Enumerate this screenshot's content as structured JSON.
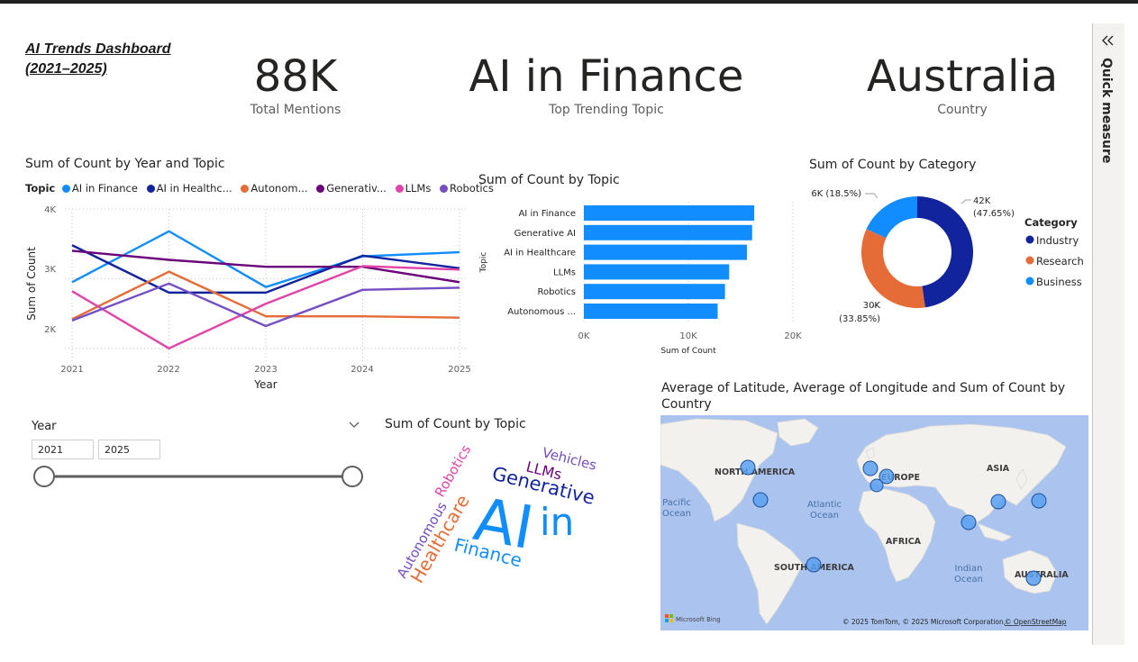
{
  "dashboard": {
    "title_line1": "AI Trends Dashboard ",
    "title_line2": "(2021–2025)"
  },
  "kpis": [
    {
      "value": "88K",
      "label": "Total Mentions"
    },
    {
      "value": "AI in Finance",
      "label": "Top Trending Topic"
    },
    {
      "value": "Australia",
      "label": "Country"
    }
  ],
  "quick_measure": {
    "label": "Quick measure",
    "collapse_icon": "double-chevron-left-icon"
  },
  "line_chart": {
    "title": "Sum of Count by Year and Topic",
    "legend_title": "Topic",
    "legend_items": [
      "AI in Finance",
      "AI in Healthc...",
      "Autonom...",
      "Generativ...",
      "LLMs",
      "Robotics"
    ],
    "xlabel": "Year",
    "ylabel": "Sum of Count",
    "x_ticks": [
      "2021",
      "2022",
      "2023",
      "2024",
      "2025"
    ],
    "y_ticks": [
      "4K",
      "3K",
      "2K"
    ]
  },
  "bar_chart": {
    "title": "Sum of Count by Topic",
    "ylabel": "Topic",
    "xlabel": "Sum of Count",
    "x_ticks": [
      "0K",
      "10K",
      "20K"
    ],
    "categories": [
      "AI in Finance",
      "Generative AI",
      "AI in Healthcare",
      "LLMs",
      "Robotics",
      "Autonomous ..."
    ]
  },
  "donut_chart": {
    "title": "Sum of Count by Category",
    "legend_title": "Category",
    "legend": [
      "Industry",
      "Research",
      "Business"
    ],
    "labels": [
      {
        "value": "42K",
        "pct": "(47.65%)"
      },
      {
        "value": "30K",
        "pct": "(33.85%)"
      },
      {
        "value": "16K (18.5%)"
      }
    ]
  },
  "slicer": {
    "title": "Year",
    "from": "2021",
    "to": "2025",
    "expand_icon": "chevron-down-icon",
    "range": [
      0,
      1
    ]
  },
  "wordcloud": {
    "title": "Sum of Count by Topic",
    "words": [
      "AI",
      "in",
      "Finance",
      "Generative",
      "LLMs",
      "Vehicles",
      "Robotics",
      "Autonomous",
      "Healthcare"
    ]
  },
  "map": {
    "title_line1": "Average of Latitude, Average of Longitude and Sum of Count by",
    "title_line2": "Country",
    "labels": [
      "NORTH AMERICA",
      "EUROPE",
      "ASIA",
      "Pacific",
      "Ocean",
      "Atlantic",
      "Ocean",
      "AFRICA",
      "SOUTH AMERICA",
      "Indian",
      "Ocean",
      "AUSTRALIA"
    ],
    "logo": "Microsoft Bing",
    "attribution": "© 2025 TomTom, © 2025 Microsoft Corporation, ",
    "attribution_link": "© OpenStreetMap"
  },
  "colors": {
    "ai_finance": "#118dff",
    "ai_healthcare": "#12239e",
    "autonomous": "#e66c37",
    "generative": "#6b007b",
    "llms": "#e044a7",
    "robotics": "#744ec2",
    "bar": "#118dff",
    "industry": "#12239e",
    "research": "#e66c37",
    "business": "#118dff"
  },
  "chart_data": [
    {
      "type": "line",
      "title": "Sum of Count by Year and Topic",
      "xlabel": "Year",
      "ylabel": "Sum of Count",
      "x": [
        2021,
        2022,
        2023,
        2024,
        2025
      ],
      "ylim": [
        1700,
        4000
      ],
      "grid": true,
      "legend_position": "top",
      "series": [
        {
          "name": "AI in Finance",
          "values": [
            2950,
            3680,
            2880,
            3320,
            3380
          ]
        },
        {
          "name": "AI in Healthc...",
          "values": [
            3480,
            2800,
            2800,
            3330,
            3150
          ]
        },
        {
          "name": "Autonom...",
          "values": [
            2420,
            3100,
            2460,
            2460,
            2440
          ]
        },
        {
          "name": "Generativ...",
          "values": [
            3400,
            3270,
            3170,
            3170,
            2950
          ]
        },
        {
          "name": "LLMs",
          "values": [
            2820,
            2000,
            2640,
            3180,
            3130
          ]
        },
        {
          "name": "Robotics",
          "values": [
            2400,
            2930,
            2320,
            2840,
            2870
          ]
        }
      ]
    },
    {
      "type": "bar",
      "orientation": "horizontal",
      "title": "Sum of Count by Topic",
      "xlabel": "Sum of Count",
      "ylabel": "Topic",
      "categories": [
        "AI in Finance",
        "Generative AI",
        "AI in Healthcare",
        "LLMs",
        "Robotics",
        "Autonomous ..."
      ],
      "values": [
        16300,
        16100,
        15600,
        13900,
        13500,
        12800
      ],
      "xlim": [
        0,
        20000
      ],
      "grid": true
    },
    {
      "type": "pie",
      "donut": true,
      "title": "Sum of Count by Category",
      "categories": [
        "Industry",
        "Research",
        "Business"
      ],
      "values": [
        42000,
        30000,
        16000
      ],
      "percent": [
        47.65,
        33.85,
        18.5
      ],
      "legend_position": "right"
    }
  ]
}
